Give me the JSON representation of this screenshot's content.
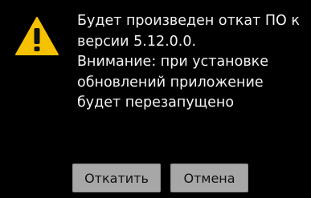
{
  "dialog": {
    "icon": "warning-icon",
    "message_lines": [
      "Будет произведен откат ПО к",
      "версии 5.12.0.0.",
      "Внимание: при установке",
      "обновлений приложение",
      "будет перезапущено"
    ],
    "buttons": {
      "rollback_label": "Откатить",
      "cancel_label": "Отмена"
    },
    "colors": {
      "background": "#000000",
      "warning_icon": "#f6c200",
      "button_bg": "#a7a7a7",
      "text": "#ffffff"
    }
  }
}
